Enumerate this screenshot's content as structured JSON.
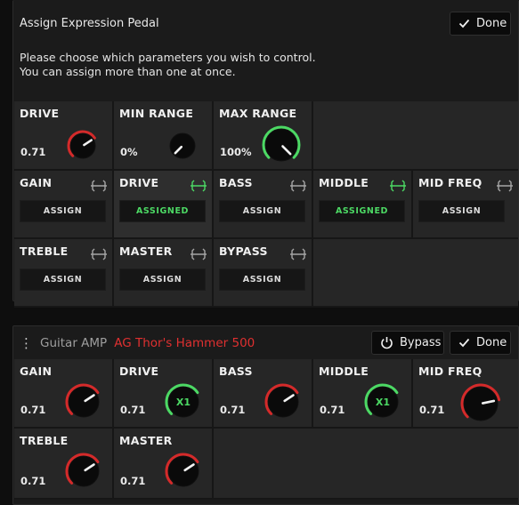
{
  "expression_panel": {
    "title": "Assign Expression Pedal",
    "done_label": "Done",
    "instructions_line1": "Please choose which parameters you wish to control.",
    "instructions_line2": "You can assign more than one at once.",
    "range_controls": [
      {
        "label": "DRIVE",
        "value": "0.71",
        "level": 0.71
      },
      {
        "label": "MIN RANGE",
        "value": "0%",
        "level": 0.0
      },
      {
        "label": "MAX RANGE",
        "value": "100%",
        "level": 1.0
      }
    ],
    "assign_params": [
      {
        "label": "GAIN",
        "button": "ASSIGN",
        "assigned": false
      },
      {
        "label": "DRIVE",
        "button": "ASSIGNED",
        "assigned": true
      },
      {
        "label": "BASS",
        "button": "ASSIGN",
        "assigned": false
      },
      {
        "label": "MIDDLE",
        "button": "ASSIGNED",
        "assigned": true
      },
      {
        "label": "MID FREQ",
        "button": "ASSIGN",
        "assigned": false
      },
      {
        "label": "TREBLE",
        "button": "ASSIGN",
        "assigned": false
      },
      {
        "label": "MASTER",
        "button": "ASSIGN",
        "assigned": false
      },
      {
        "label": "BYPASS",
        "button": "ASSIGN",
        "assigned": false
      }
    ]
  },
  "amp_panel": {
    "category": "Guitar AMP",
    "model": "AG Thor's Hammer 500",
    "bypass_label": "Bypass",
    "done_label": "Done",
    "controls": [
      {
        "label": "GAIN",
        "value": "0.71",
        "level": 0.71,
        "expr": false
      },
      {
        "label": "DRIVE",
        "value": "0.71",
        "level": 0.71,
        "expr": true,
        "badge": "X1"
      },
      {
        "label": "BASS",
        "value": "0.71",
        "level": 0.71,
        "expr": false
      },
      {
        "label": "MIDDLE",
        "value": "0.71",
        "level": 0.71,
        "expr": true,
        "badge": "X1"
      },
      {
        "label": "MID FREQ",
        "value": "0.71",
        "level": 0.79,
        "expr": false
      },
      {
        "label": "TREBLE",
        "value": "0.71",
        "level": 0.71,
        "expr": false
      },
      {
        "label": "MASTER",
        "value": "0.71",
        "level": 0.71,
        "expr": false
      }
    ]
  },
  "colors": {
    "accent_green": "#4cd964",
    "accent_red": "#d42a2a",
    "panel_bg": "#1b1b1b",
    "cell_bg": "#262626"
  },
  "icons": {
    "done": "check-icon",
    "bypass": "power-icon",
    "assign_indicator": "expression-pedal-icon",
    "menu": "vertical-dots-icon"
  }
}
